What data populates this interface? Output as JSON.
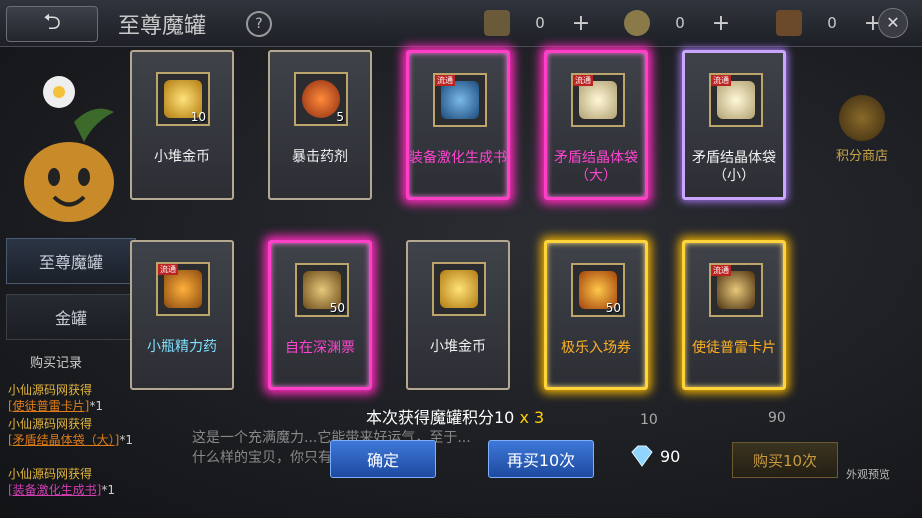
{
  "header": {
    "title": "至尊魔罐",
    "help": "?",
    "resources": [
      {
        "icon": "ticket-icon",
        "value": "0",
        "plus": "+"
      },
      {
        "icon": "coin-icon",
        "value": "0",
        "plus": "+"
      },
      {
        "icon": "card-icon",
        "value": "0",
        "plus": "+"
      }
    ],
    "close": "✕"
  },
  "sidebar": {
    "tabs": [
      "至尊魔罐",
      "金罐"
    ],
    "log_title": "购买记录",
    "log": [
      {
        "user": "小仙源码网获得",
        "item": "[使徒普雷卡片]",
        "suffix": "*1",
        "color": "orange"
      },
      {
        "user": "小仙源码网获得",
        "item": "[矛盾结晶体袋（大）]",
        "suffix": "*1",
        "color": "orange"
      },
      {
        "user": "小仙源码网获得",
        "item": "[装备激化生成书]",
        "suffix": "*1",
        "color": "pink"
      }
    ]
  },
  "background": {
    "description": "这是一个充满魔力...它能带来好运气，至于...什么样的宝贝，你只有打开它才知道！",
    "score_shop": "积分商店",
    "buy10": "购买10次",
    "preview": "外观预览",
    "left_cost": "10",
    "right_cost": "90"
  },
  "rewards": [
    {
      "name": "小堆金币",
      "qty": "10",
      "frame": "normal",
      "name_color": "white",
      "icon": "gold-coins-icon",
      "badge": ""
    },
    {
      "name": "暴击药剂",
      "qty": "5",
      "frame": "normal",
      "name_color": "white",
      "icon": "potion-icon",
      "badge": ""
    },
    {
      "name": "装备激化生成书",
      "qty": "",
      "frame": "pink",
      "name_color": "pink",
      "icon": "enhance-book-icon",
      "badge": "流通"
    },
    {
      "name": "矛盾结晶体袋（大）",
      "qty": "",
      "frame": "pink",
      "name_color": "pink",
      "icon": "crystal-bag-large-icon",
      "badge": "流通"
    },
    {
      "name": "矛盾结晶体袋（小）",
      "qty": "",
      "frame": "purple",
      "name_color": "white",
      "icon": "crystal-bag-small-icon",
      "badge": "流通"
    },
    {
      "name": "小瓶精力药",
      "qty": "",
      "frame": "normal",
      "name_color": "cyan",
      "icon": "stamina-potion-icon",
      "badge": "流通"
    },
    {
      "name": "自在深渊票",
      "qty": "50",
      "frame": "pink",
      "name_color": "pink",
      "icon": "abyss-ticket-icon",
      "badge": ""
    },
    {
      "name": "小堆金币",
      "qty": "",
      "frame": "normal",
      "name_color": "white",
      "icon": "gold-coins-icon",
      "badge": ""
    },
    {
      "name": "极乐入场券",
      "qty": "50",
      "frame": "gold",
      "name_color": "orange",
      "icon": "entry-ticket-icon",
      "badge": ""
    },
    {
      "name": "使徒普雷卡片",
      "qty": "",
      "frame": "gold",
      "name_color": "orange",
      "icon": "apostle-card-icon",
      "badge": "流通"
    }
  ],
  "result": {
    "text": "本次获得魔罐积分10",
    "multiplier": "x 3"
  },
  "buttons": {
    "confirm": "确定",
    "again": "再买10次",
    "cost": "90"
  },
  "colors": {
    "pink": "#ff3fc8",
    "gold": "#ffd43a",
    "blue_button": "#2f63c4"
  }
}
